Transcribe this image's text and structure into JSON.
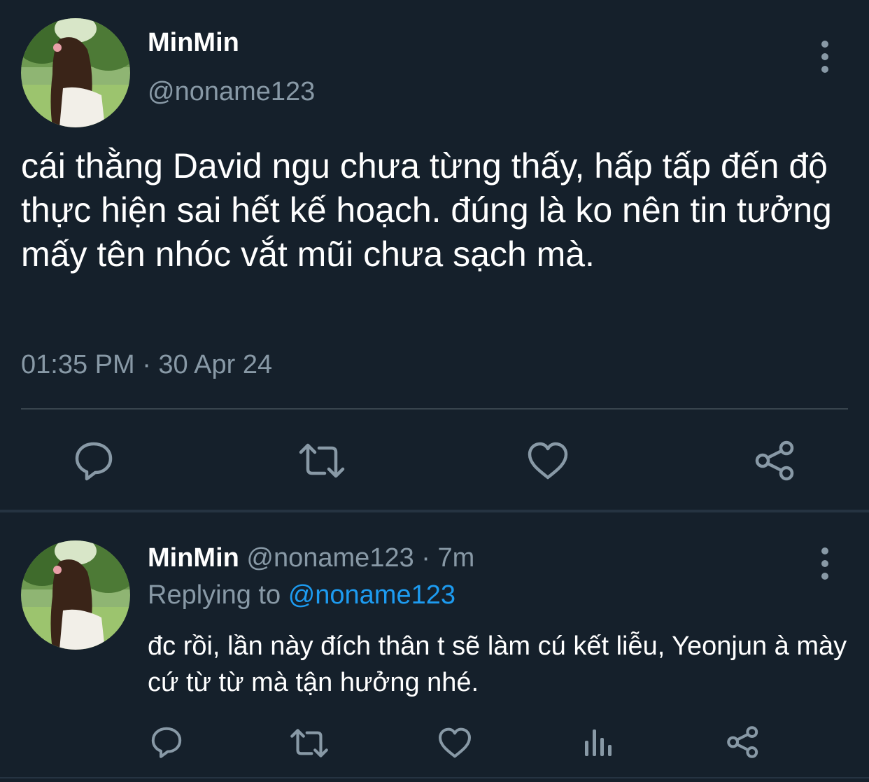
{
  "main_tweet": {
    "display_name": "MinMin",
    "handle": "@noname123",
    "text": "cái thằng David ngu chưa từng thấy, hấp tấp đến độ thực hiện sai hết kế hoạch. đúng là ko nên tin tưởng mấy tên nhóc vắt mũi chưa sạch mà.",
    "timestamp": "01:35 PM · 30 Apr 24",
    "actions": [
      "reply-icon",
      "retweet-icon",
      "like-icon",
      "share-icon"
    ]
  },
  "reply_tweet": {
    "display_name": "MinMin",
    "meta": "@noname123 · 7m",
    "replying_prefix": "Replying to",
    "replying_handle": "@noname123",
    "text": "đc rồi, lần này đích thân t sẽ làm cú kết liễu, Yeonjun à mày cứ từ từ mà tận hưởng nhé.",
    "actions": [
      "reply-icon",
      "retweet-icon",
      "like-icon",
      "analytics-icon",
      "share-icon"
    ]
  },
  "colors": {
    "background": "#15202b",
    "text_primary": "#ffffff",
    "text_secondary": "#8899a6",
    "accent": "#1d9bf0",
    "divider": "#38444d"
  }
}
